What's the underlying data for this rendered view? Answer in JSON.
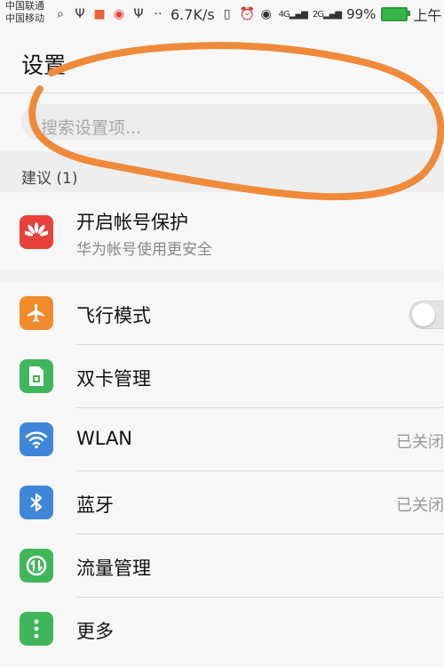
{
  "status_bar": {
    "carrier_1": "中国联通",
    "carrier_2": "中国移动",
    "net_speed": "6.7K/s",
    "signal_1": "4G",
    "signal_2": "2G",
    "battery": "99%",
    "time": "上午"
  },
  "header": {
    "title": "设置"
  },
  "search": {
    "placeholder": "搜索设置项..."
  },
  "suggestions": {
    "section_label": "建议 (1)",
    "item": {
      "title": "开启帐号保护",
      "subtitle": "华为帐号使用更安全",
      "icon": "huawei-logo-icon",
      "color": "#e8403a"
    }
  },
  "settings": [
    {
      "label": "飞行模式",
      "icon": "airplane-icon",
      "color": "#f08a2c",
      "toggle": false
    },
    {
      "label": "双卡管理",
      "icon": "sim-card-icon",
      "color": "#3fb65a"
    },
    {
      "label": "WLAN",
      "icon": "wifi-icon",
      "color": "#3f86d8",
      "status": "已关闭"
    },
    {
      "label": "蓝牙",
      "icon": "bluetooth-icon",
      "color": "#3f86d8",
      "status": "已关闭"
    },
    {
      "label": "流量管理",
      "icon": "data-usage-icon",
      "color": "#3fb65a"
    },
    {
      "label": "更多",
      "icon": "more-icon",
      "color": "#3fb65a"
    }
  ],
  "annotation_color": "#ef8a3a"
}
